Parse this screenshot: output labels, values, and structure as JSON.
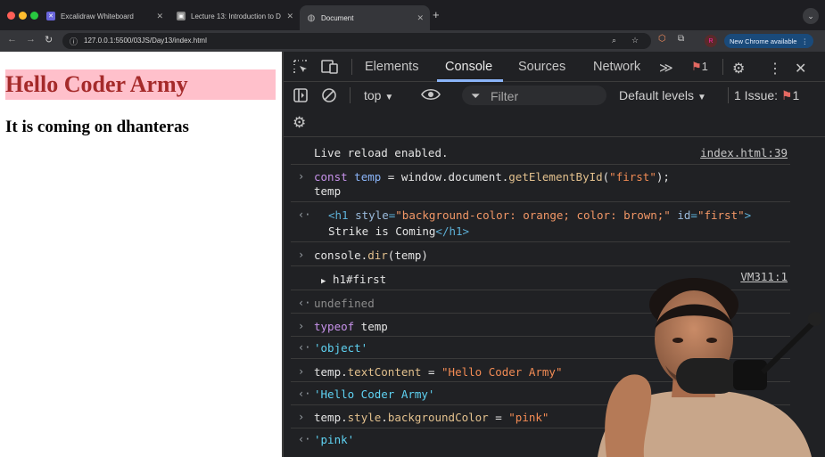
{
  "browser": {
    "tabs": [
      {
        "label": "Excalidraw Whiteboard"
      },
      {
        "label": "Lecture 13: Introduction to D"
      },
      {
        "label": "Document"
      }
    ],
    "url": "127.0.0.1:5500/03JS/Day13/index.html",
    "profile_initial": "R",
    "new_chrome_label": "New Chrome available"
  },
  "page": {
    "heading": "Hello Coder Army",
    "paragraph": "It is coming on dhanteras"
  },
  "devtools": {
    "tabs": [
      "Elements",
      "Console",
      "Sources",
      "Network"
    ],
    "active_tab": "Console",
    "error_badge": "1",
    "context": "top",
    "filter_placeholder": "Filter",
    "levels": "Default levels",
    "issues": "1 Issue:",
    "issues_count": "1"
  },
  "console": {
    "live_reload": "Live reload enabled.",
    "live_reload_src": "index.html:39",
    "cmd1_kw": "const",
    "cmd1_var": "temp",
    "cmd1_eq": " = window.document.",
    "cmd1_fn": "getElementById",
    "cmd1_open": "(",
    "cmd1_arg": "\"first\"",
    "cmd1_close": ");",
    "cmd1_line2": "temp",
    "res1_open": "<h1",
    "res1_attr1": " style",
    "res1_eq1": "=",
    "res1_val1": "\"background-color: orange; color: brown;\"",
    "res1_attr2": " id",
    "res1_eq2": "=",
    "res1_val2": "\"first\"",
    "res1_gt": ">",
    "res1_text": "Strike is Coming",
    "res1_close": "</h1>",
    "cmd2_pre": "console.",
    "cmd2_fn": "dir",
    "cmd2_post": "(temp)",
    "dir_result": "h1#first",
    "dir_src": "VM311:1",
    "undef": "undefined",
    "cmd3_kw": "typeof",
    "cmd3_rest": " temp",
    "res3": "'object'",
    "cmd4_pre": "temp.",
    "cmd4_prop": "textContent",
    "cmd4_eq": " = ",
    "cmd4_str": "\"Hello Coder Army\"",
    "res4": "'Hello Coder Army'",
    "cmd5_pre": "temp.",
    "cmd5_prop": "style",
    "cmd5_dot": ".",
    "cmd5_prop2": "backgroundColor",
    "cmd5_eq": " = ",
    "cmd5_str": "\"pink\"",
    "res5": "'pink'"
  },
  "colors": {
    "heading_bg": "#ffc0cb",
    "heading_fg": "#a52a2a",
    "devtools_bg": "#202124",
    "accent": "#8ab4f8"
  }
}
